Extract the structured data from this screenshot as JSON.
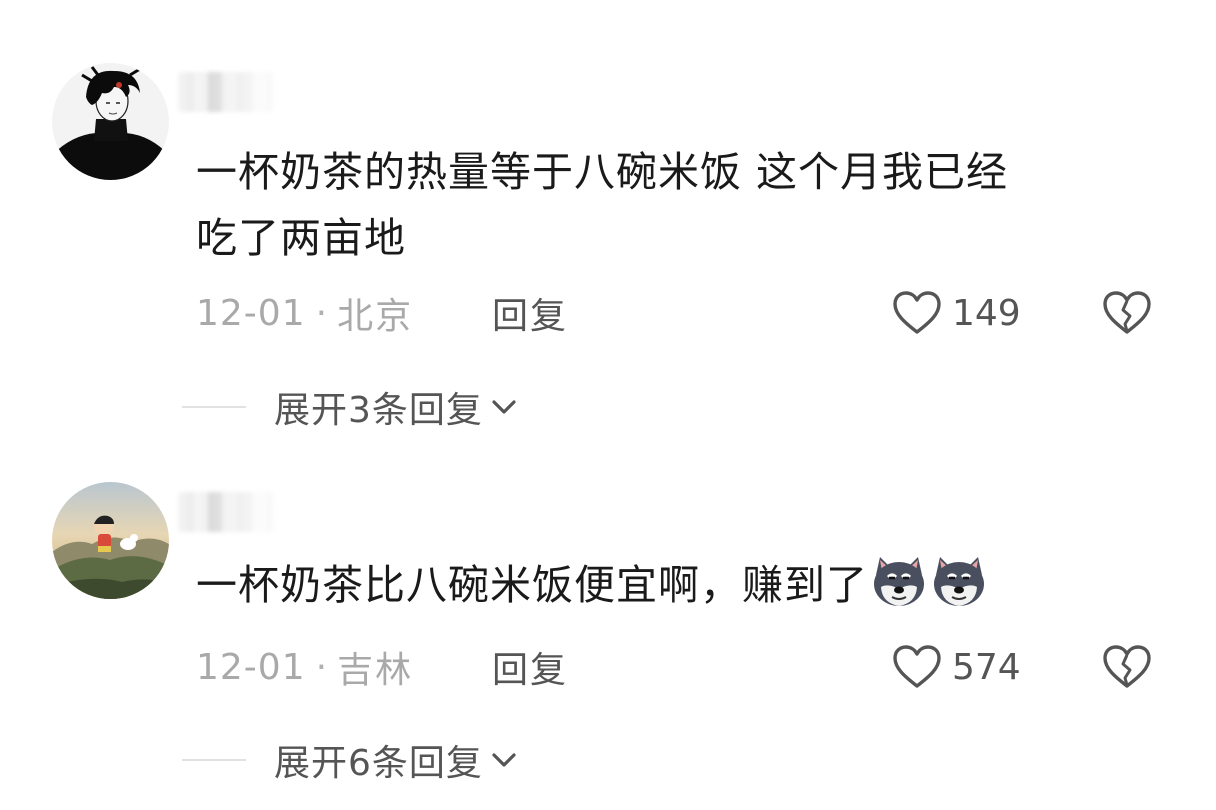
{
  "comments": [
    {
      "text_line1": "一杯奶茶的热量等于八碗米饭 这个月我已经",
      "text_line2": "吃了两亩地",
      "date": "12-01",
      "separator": "·",
      "location": "北京",
      "reply_label": "回复",
      "like_count": "149",
      "expand_label": "展开3条回复",
      "avatar_icon": "avatar-boy-black-turtleneck"
    },
    {
      "text": "一杯奶茶比八碗米饭便宜啊，赚到了",
      "emojis": [
        "doge-husky-icon",
        "doge-husky-icon"
      ],
      "date": "12-01",
      "separator": "·",
      "location": "吉林",
      "reply_label": "回复",
      "like_count": "574",
      "expand_label": "展开6条回复",
      "avatar_icon": "avatar-cartoon-hilltop"
    }
  ],
  "icons": {
    "like": "heart-outline-icon",
    "dislike": "broken-heart-icon",
    "expand": "chevron-down-icon"
  },
  "colors": {
    "text_primary": "#1a1a1a",
    "text_secondary": "#a9a9a9",
    "action_text": "#555555"
  }
}
